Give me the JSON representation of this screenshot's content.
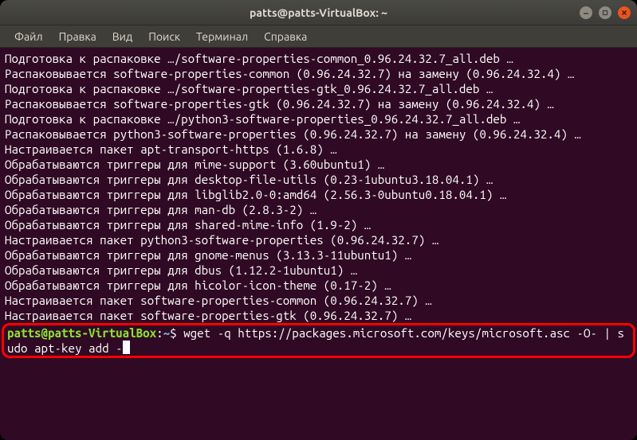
{
  "window": {
    "title": "patts@patts-VirtualBox: ~"
  },
  "menu": {
    "file": "Файл",
    "edit": "Правка",
    "view": "Вид",
    "search": "Поиск",
    "terminal": "Терминал",
    "help": "Справка"
  },
  "output": [
    "Подготовка к распаковке …/software-properties-common_0.96.24.32.7_all.deb …",
    "Распаковывается software-properties-common (0.96.24.32.7) на замену (0.96.24.32.4) …",
    "Подготовка к распаковке …/software-properties-gtk_0.96.24.32.7_all.deb …",
    "Распаковывается software-properties-gtk (0.96.24.32.7) на замену (0.96.24.32.4) …",
    "Подготовка к распаковке …/python3-software-properties_0.96.24.32.7_all.deb …",
    "Распаковывается python3-software-properties (0.96.24.32.7) на замену (0.96.24.32.4) …",
    "Настраивается пакет apt-transport-https (1.6.8) …",
    "Обрабатываются триггеры для mime-support (3.60ubuntu1) …",
    "Обрабатываются триггеры для desktop-file-utils (0.23-1ubuntu3.18.04.1) …",
    "Обрабатываются триггеры для libglib2.0-0:amd64 (2.56.3-0ubuntu0.18.04.1) …",
    "Обрабатываются триггеры для man-db (2.8.3-2) …",
    "Обрабатываются триггеры для shared-mime-info (1.9-2) …",
    "Настраивается пакет python3-software-properties (0.96.24.32.7) …",
    "Обрабатываются триггеры для gnome-menus (3.13.3-11ubuntu1) …",
    "Обрабатываются триггеры для dbus (1.12.2-1ubuntu1) …",
    "Обрабатываются триггеры для hicolor-icon-theme (0.17-2) …",
    "Настраивается пакет software-properties-common (0.96.24.32.7) …",
    "Настраивается пакет software-properties-gtk (0.96.24.32.7) …"
  ],
  "prompt": {
    "user_host": "patts@patts-VirtualBox",
    "colon": ":",
    "path": "~",
    "dollar": "$ ",
    "command": "wget -q https://packages.microsoft.com/keys/microsoft.asc -O- | sudo apt-key add -"
  }
}
